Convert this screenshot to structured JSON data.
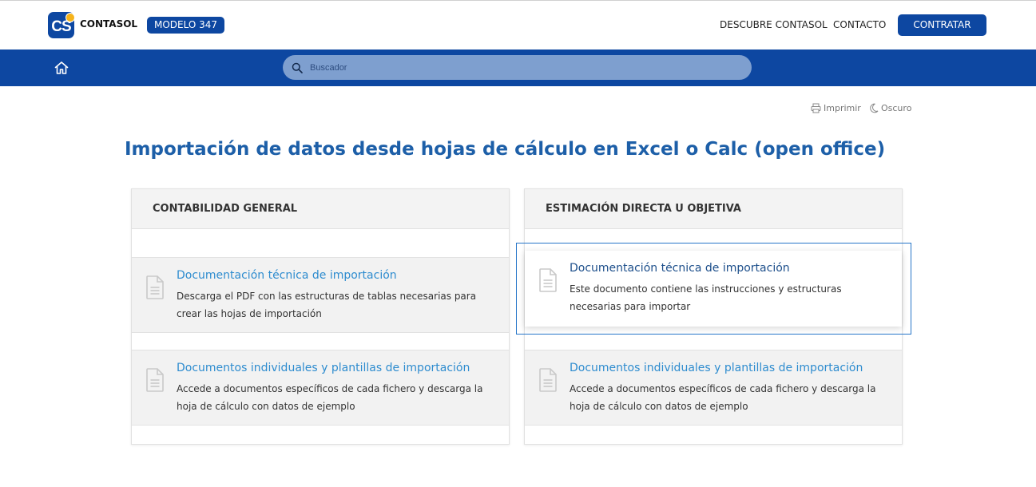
{
  "header": {
    "logo_text": "CS",
    "brand": "CONTASOL",
    "model_badge": "MODELO 347",
    "nav": [
      "DESCUBRE CONTASOL",
      "CONTACTO"
    ],
    "cta": "CONTRATAR"
  },
  "search": {
    "placeholder": "Buscador"
  },
  "tools": {
    "print": "Imprimir",
    "dark": "Oscuro"
  },
  "page_title": "Importación de datos desde hojas de cálculo en Excel o Calc (open office)",
  "panels": [
    {
      "heading": "CONTABILIDAD GENERAL",
      "items": [
        {
          "title": "Documentación técnica de importación",
          "desc": "Descarga el PDF con las estructuras de tablas necesarias para crear las hojas de importación"
        },
        {
          "title": "Documentos individuales y plantillas de importación",
          "desc": "Accede a documentos específicos de cada fichero y descarga la hoja de cálculo con datos de ejemplo"
        }
      ]
    },
    {
      "heading": "ESTIMACIÓN DIRECTA U OBJETIVA",
      "items": [
        {
          "title": "Documentación técnica de importación",
          "desc": "Este documento contiene las instrucciones y estructuras necesarias para importar"
        },
        {
          "title": "Documentos individuales y plantillas de importación",
          "desc": "Accede a documentos específicos de cada fichero y descarga la hoja de cálculo con datos de ejemplo"
        }
      ]
    }
  ],
  "colors": {
    "brand_blue": "#0d47a1",
    "title_blue": "#1d5fa8",
    "link_blue": "#2e8ccf",
    "accent_yellow": "#f5b31b"
  },
  "icons": [
    "home-icon",
    "search-icon",
    "print-icon",
    "moon-icon",
    "document-icon"
  ]
}
